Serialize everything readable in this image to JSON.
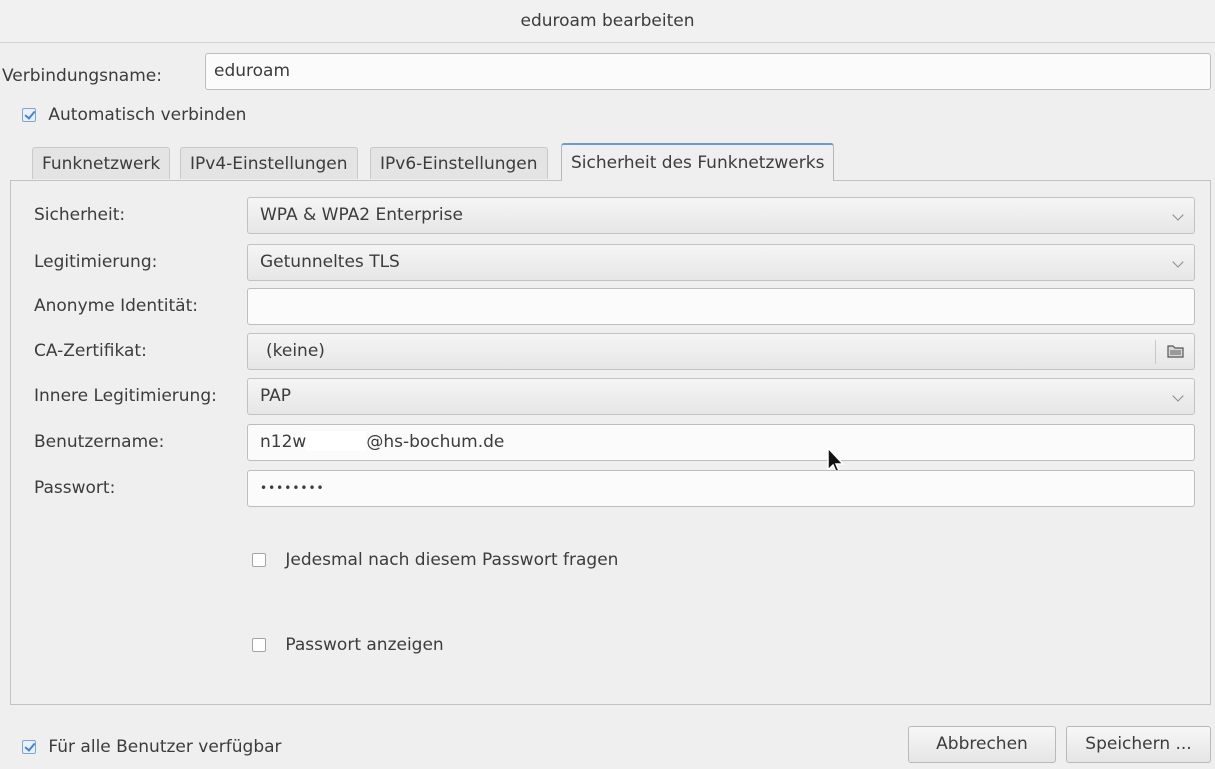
{
  "window": {
    "title": "eduroam bearbeiten"
  },
  "connection": {
    "name_label": "Verbindungsname:",
    "name_value": "eduroam",
    "autoconnect_label": "Automatisch verbinden",
    "autoconnect_checked": true
  },
  "tabs": [
    {
      "label": "Funknetzwerk",
      "active": false
    },
    {
      "label": "IPv4-Einstellungen",
      "active": false
    },
    {
      "label": "IPv6-Einstellungen",
      "active": false
    },
    {
      "label": "Sicherheit des Funknetzwerks",
      "active": true
    }
  ],
  "security": {
    "security_label": "Sicherheit:",
    "security_value": "WPA & WPA2 Enterprise",
    "auth_label": "Legitimierung:",
    "auth_value": "Getunneltes TLS",
    "anon_label": "Anonyme Identität:",
    "anon_value": "",
    "ca_label": "CA-Zertifikat:",
    "ca_value": "(keine)",
    "inner_auth_label": "Innere Legitimierung:",
    "inner_auth_value": "PAP",
    "username_label": "Benutzername:",
    "username_prefix": "n12w",
    "username_suffix": "@hs-bochum.de",
    "password_label": "Passwort:",
    "password_value": "••••••••",
    "ask_password_label": "Jedesmal nach diesem Passwort fragen",
    "ask_password_checked": false,
    "show_password_label": "Passwort anzeigen",
    "show_password_checked": false
  },
  "footer": {
    "all_users_label": "Für alle Benutzer verfügbar",
    "all_users_checked": true,
    "cancel_label": "Abbrechen",
    "save_label": "Speichern ..."
  },
  "colors": {
    "accent": "#6d9ad1",
    "window_bg": "#efefef",
    "check_mark": "#4a82c4"
  }
}
